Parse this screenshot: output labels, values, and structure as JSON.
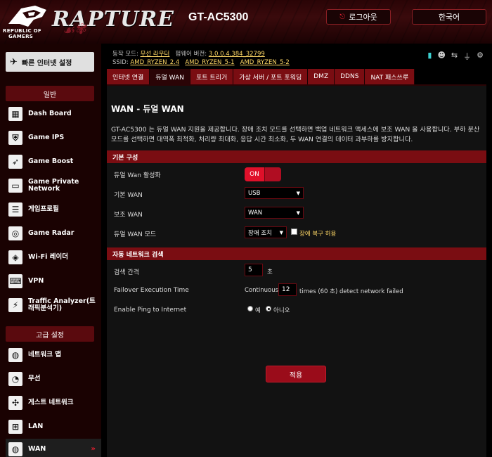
{
  "header": {
    "brand": "RAPTURE",
    "rog_line1": "REPUBLIC OF",
    "rog_line2": "GAMERS",
    "model": "GT-AC5300",
    "logout": "로그아웃",
    "language": "한국어"
  },
  "sidebar": {
    "quick_setup": "빠른 인터넷 설정",
    "section_general": "일반",
    "general_items": [
      {
        "label": "Dash Board",
        "icon": "dashboard-icon"
      },
      {
        "label": "Game IPS",
        "icon": "shield-icon"
      },
      {
        "label": "Game Boost",
        "icon": "rocket-icon"
      },
      {
        "label": "Game Private Network",
        "icon": "network-icon"
      },
      {
        "label": "게임프로필",
        "icon": "profile-icon"
      },
      {
        "label": "Game Radar",
        "icon": "radar-icon"
      },
      {
        "label": "Wi-Fi 레이더",
        "icon": "wifi-icon"
      },
      {
        "label": "VPN",
        "icon": "vpn-icon"
      },
      {
        "label": "Traffic Analyzer(트래픽분석기)",
        "icon": "traffic-icon"
      }
    ],
    "section_advanced": "고급 설정",
    "advanced_items": [
      {
        "label": "네트워크 맵",
        "icon": "globe-icon"
      },
      {
        "label": "무선",
        "icon": "wireless-icon"
      },
      {
        "label": "게스트 네트워크",
        "icon": "guest-network-icon"
      },
      {
        "label": "LAN",
        "icon": "lan-icon"
      },
      {
        "label": "WAN",
        "icon": "wan-globe-icon"
      }
    ]
  },
  "status": {
    "mode_label": "동작 모드:",
    "mode_value": "무선 라우터",
    "firmware_label": "펌웨어 버전:",
    "firmware_value": "3.0.0.4.384_32799",
    "ssid_label": "SSID:",
    "ssid_values": [
      "AMD_RYZEN_2.4",
      "AMD_RYZEN_5-1",
      "AMD_RYZEN_5-2"
    ]
  },
  "tabs": [
    "인터넷 연결",
    "듀얼 WAN",
    "포트 트리거",
    "가상 서버 / 포트 포워딩",
    "DMZ",
    "DDNS",
    "NAT 패스쓰루"
  ],
  "panel": {
    "title": "WAN - 듀얼 WAN",
    "description": "GT-AC5300 는 듀얼 WAN 지원을 제공합니다. 장애 조치 모드를 선택하면 백업 네트워크 액세스에 보조 WAN 을 사용합니다. 부하 분산 모드를 선택하면 대역폭 최적화, 처리량 최대화, 응답 시간 최소화, 두 WAN 연결의 데이터 과부하를 방지합니다.",
    "section_basic": "기본 구성",
    "enable_label": "듀얼 Wan 활성화",
    "enable_value": "ON",
    "primary_label": "기본 WAN",
    "primary_value": "USB",
    "secondary_label": "보조 WAN",
    "secondary_value": "WAN",
    "mode_label": "듀얼 WAN 모드",
    "mode_value": "장애 조치",
    "failback_label": "장애 복구 허용",
    "section_detect": "자동 네트워크 검색",
    "interval_label": "검색 간격",
    "interval_value": "5",
    "interval_unit": "초",
    "failover_label": "Failover Execution Time",
    "failover_prefix": "Continuous",
    "failover_value": "12",
    "failover_suffix": "times (60 초) detect network failed",
    "ping_label": "Enable Ping to Internet",
    "ping_yes": "예",
    "ping_no": "아니오",
    "apply": "적용"
  }
}
